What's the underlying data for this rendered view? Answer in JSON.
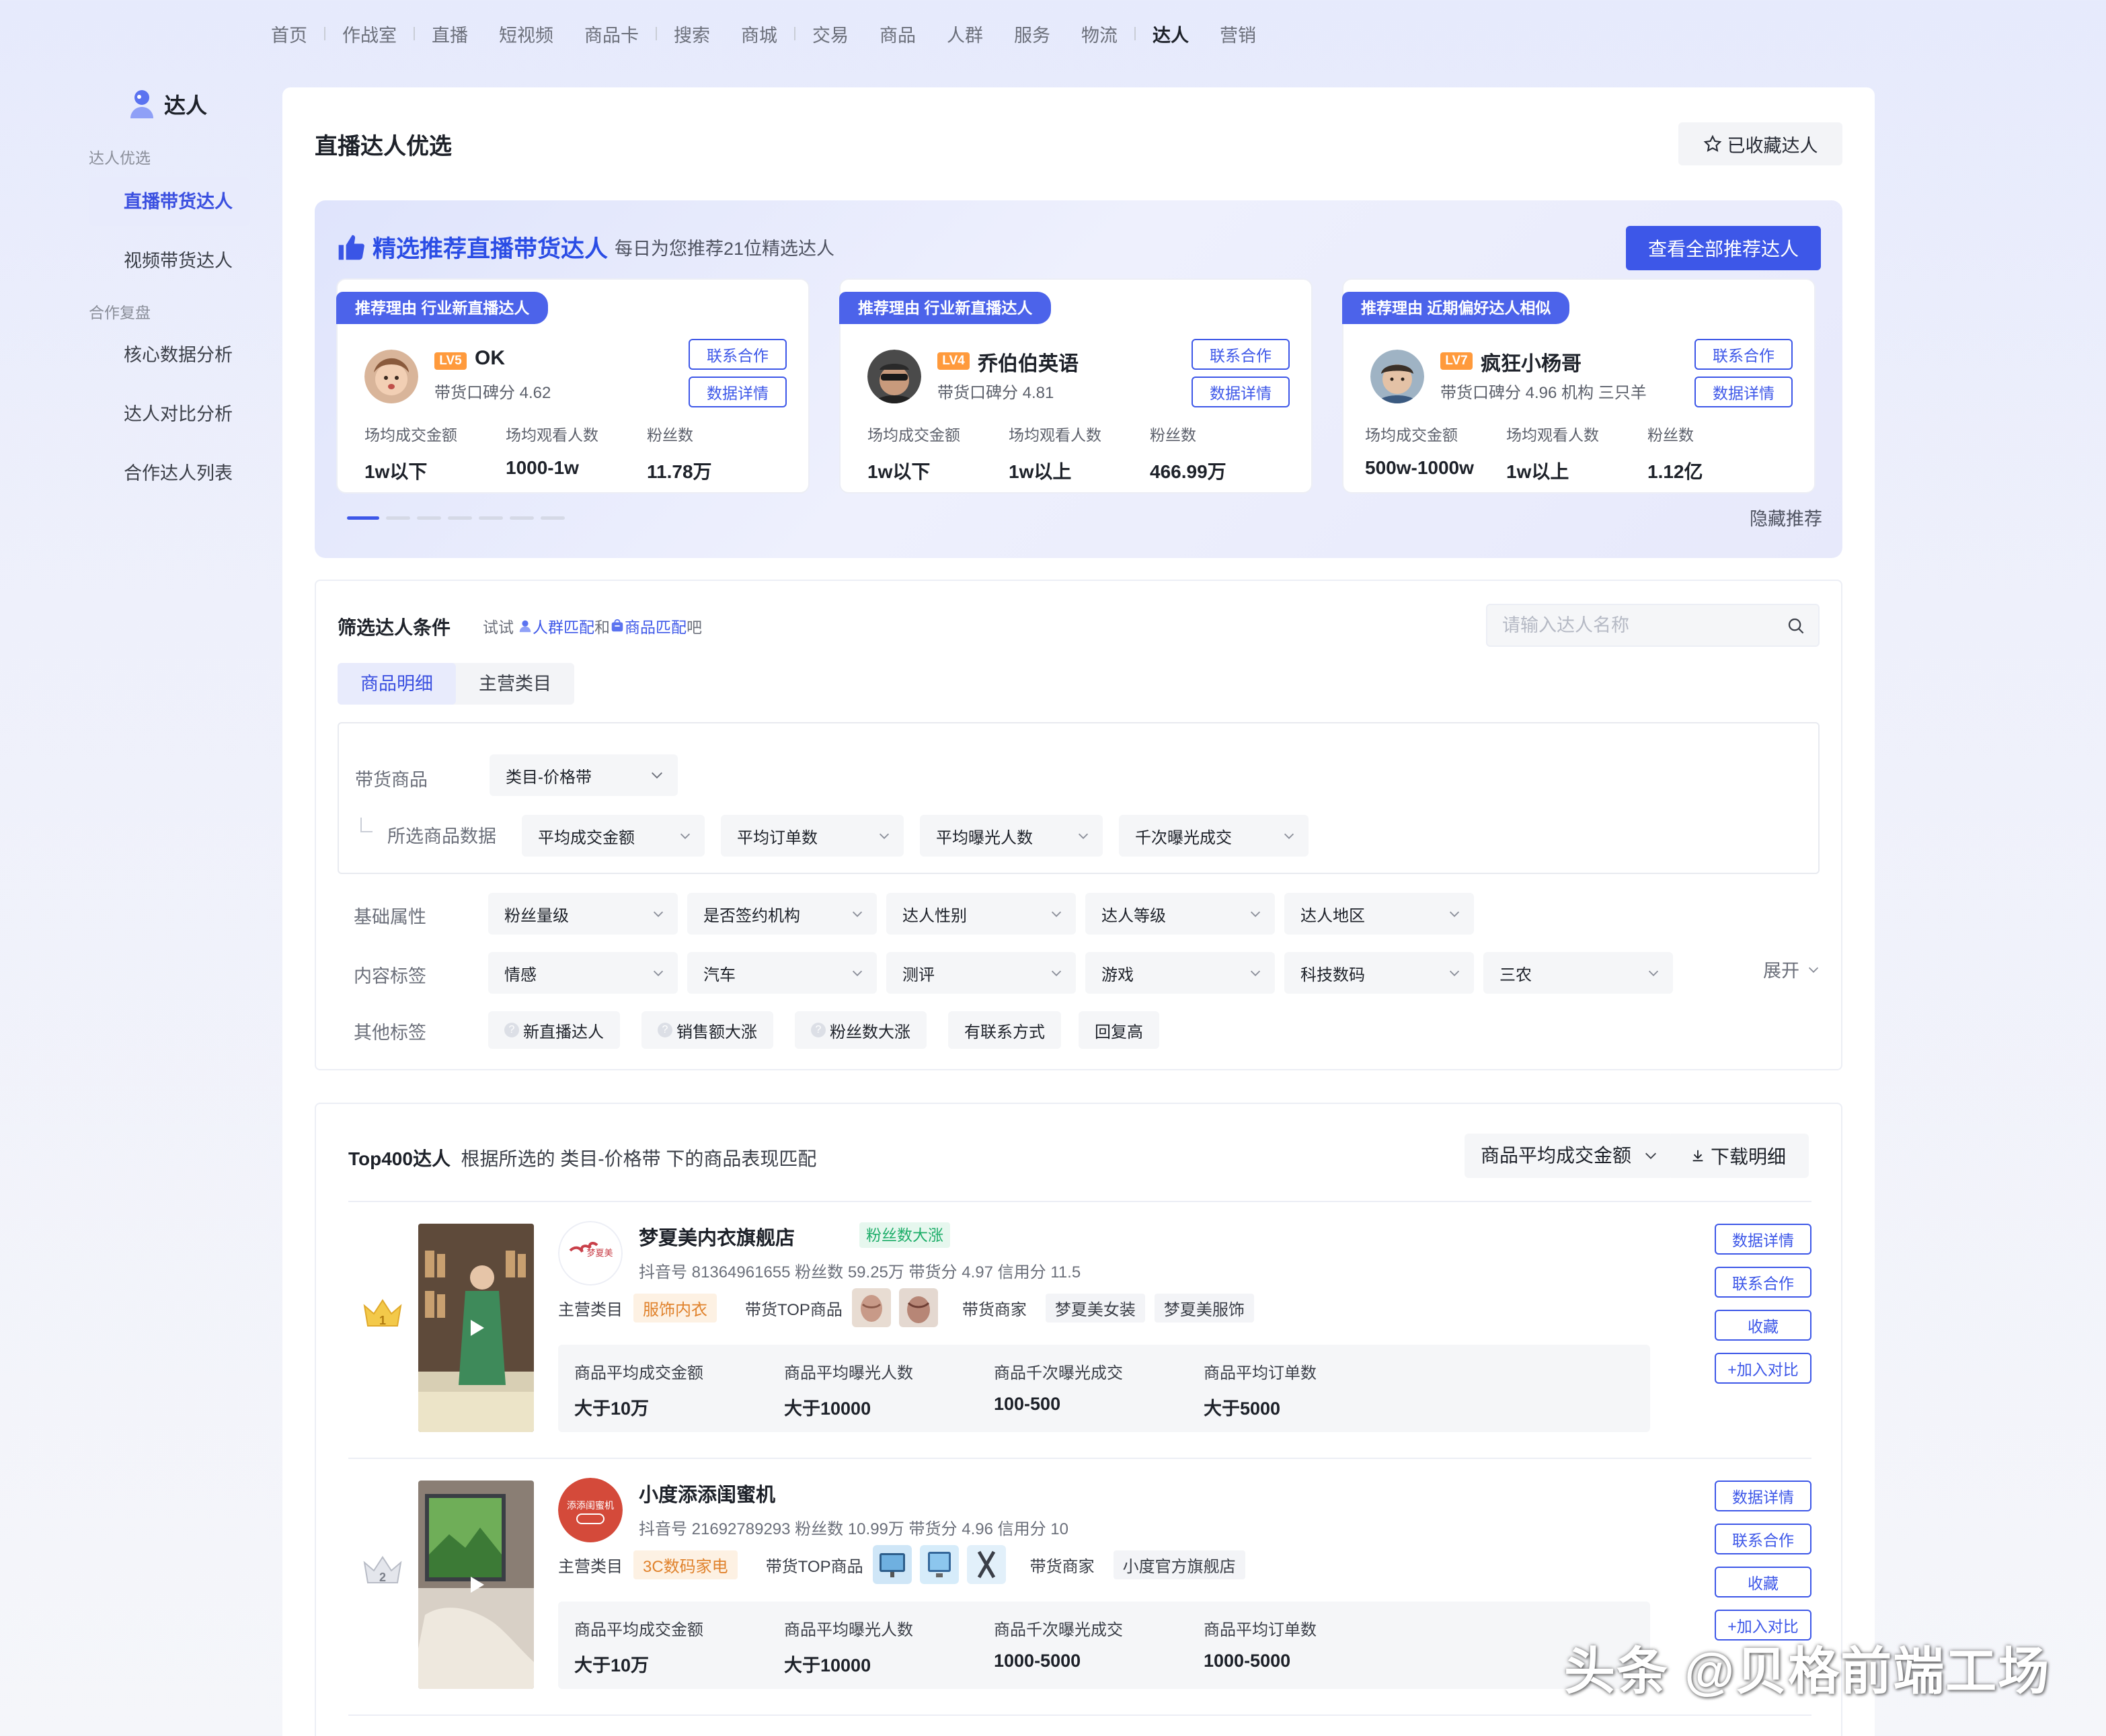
{
  "topnav": [
    "首页",
    "作战室",
    "直播",
    "短视频",
    "商品卡",
    "搜索",
    "商城",
    "交易",
    "商品",
    "人群",
    "服务",
    "物流",
    "达人",
    "营销"
  ],
  "topnav_active": 12,
  "sidebar": {
    "title": "达人",
    "group1": "达人优选",
    "item1": "直播带货达人",
    "item2": "视频带货达人",
    "group2": "合作复盘",
    "item3": "核心数据分析",
    "item4": "达人对比分析",
    "item5": "合作达人列表"
  },
  "page": {
    "title": "直播达人优选",
    "fav_label": "已收藏达人"
  },
  "rec": {
    "title": "精选推荐直播带货达人",
    "subtitle": "每日为您推荐21位精选达人",
    "view_all": "查看全部推荐达人",
    "hide": "隐藏推荐",
    "contact": "联系合作",
    "detail": "数据详情",
    "metric_labels": [
      "场均成交金额",
      "场均观看人数",
      "粉丝数"
    ],
    "cards": [
      {
        "reason": "推荐理由  行业新直播达人",
        "level": "LV5",
        "name": "OK",
        "score": "带货口碑分 4.62",
        "m1": "1w以下",
        "m2": "1000-1w",
        "m3": "11.78万"
      },
      {
        "reason": "推荐理由  行业新直播达人",
        "level": "LV4",
        "name": "乔伯伯英语",
        "score": "带货口碑分 4.81",
        "m1": "1w以下",
        "m2": "1w以上",
        "m3": "466.99万"
      },
      {
        "reason": "推荐理由  近期偏好达人相似",
        "level": "LV7",
        "name": "疯狂小杨哥",
        "score": "带货口碑分 4.96   机构 三只羊",
        "m1": "500w-1000w",
        "m2": "1w以上",
        "m3": "1.12亿"
      }
    ]
  },
  "filter": {
    "title": "筛选达人条件",
    "try": "试试",
    "link1": "人群匹配",
    "and": "和",
    "link2": "商品匹配",
    "ba": "吧",
    "search_placeholder": "请输入达人名称",
    "tab1": "商品明细",
    "tab2": "主营类目",
    "goods_label": "带货商品",
    "goods_select": "类目-价格带",
    "data_label": "所选商品数据",
    "data_selects": [
      "平均成交金额",
      "平均订单数",
      "平均曝光人数",
      "千次曝光成交"
    ],
    "basic_label": "基础属性",
    "basic_selects": [
      "粉丝量级",
      "是否签约机构",
      "达人性别",
      "达人等级",
      "达人地区"
    ],
    "content_label": "内容标签",
    "content_selects": [
      "情感",
      "汽车",
      "测评",
      "游戏",
      "科技数码",
      "三农"
    ],
    "other_label": "其他标签",
    "other_chips": [
      "新直播达人",
      "销售额大涨",
      "粉丝数大涨",
      "有联系方式",
      "回复高"
    ],
    "expand": "展开"
  },
  "list": {
    "title_bold": "Top400达人",
    "title_rest": "根据所选的 类目-价格带 下的商品表现匹配",
    "sort": "商品平均成交金额",
    "download": "下载明细",
    "labels": {
      "cat": "主营类目",
      "top": "带货TOP商品",
      "merchant": "带货商家"
    },
    "stat_labels": [
      "商品平均成交金额",
      "商品平均曝光人数",
      "商品千次曝光成交",
      "商品平均订单数"
    ],
    "actions": [
      "数据详情",
      "联系合作",
      "收藏",
      "+加入对比"
    ],
    "rows": [
      {
        "rank": "1",
        "name": "梦夏美内衣旗舰店",
        "tag": "粉丝数大涨",
        "meta": "抖音号 81364961655   粉丝数 59.25万   带货分 4.97   信用分 11.5",
        "cat": "服饰内衣",
        "merchants": [
          "梦夏美女装",
          "梦夏美服饰"
        ],
        "stats": [
          "大于10万",
          "大于10000",
          "100-500",
          "大于5000"
        ],
        "avatar_text": "梦夏美"
      },
      {
        "rank": "2",
        "name": "小度添添闺蜜机",
        "tag": "",
        "meta": "抖音号 21692789293   粉丝数 10.99万   带货分 4.96   信用分 10",
        "cat": "3C数码家电",
        "merchants": [
          "小度官方旗舰店"
        ],
        "stats": [
          "大于10万",
          "大于10000",
          "1000-5000",
          "1000-5000"
        ],
        "avatar_text": "添添闺蜜机"
      }
    ]
  },
  "watermark": "头条 @贝格前端工场",
  "colors": {
    "accent": "#3d57e8",
    "rec_title": "#2b4de5",
    "level": "#ff9a3c",
    "tag_green": "#1fae6a",
    "cat_orange": "#e0822c"
  }
}
